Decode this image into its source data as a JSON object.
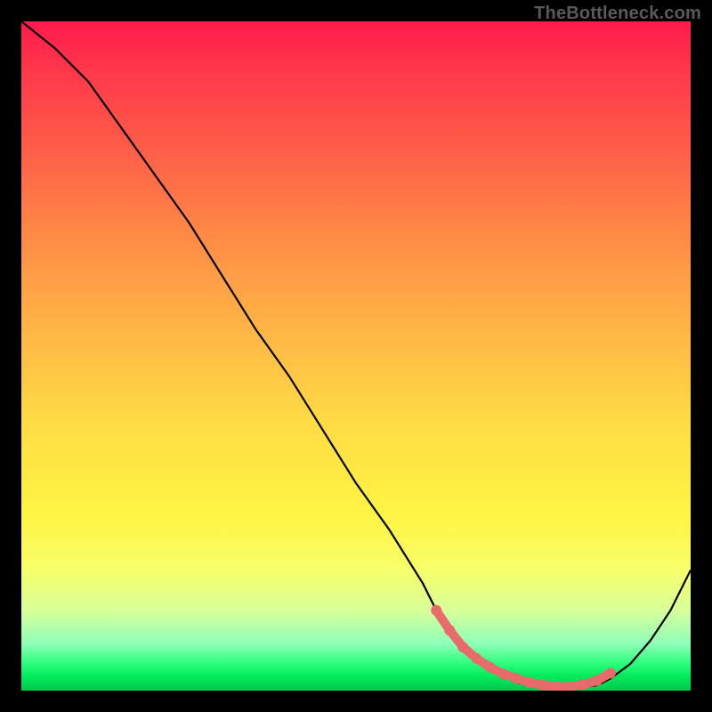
{
  "attribution": "TheBottleneck.com",
  "chart_data": {
    "type": "line",
    "title": "",
    "xlabel": "",
    "ylabel": "",
    "xlim": [
      0,
      100
    ],
    "ylim": [
      0,
      100
    ],
    "series": [
      {
        "name": "bottleneck-curve",
        "x": [
          0,
          5,
          10,
          15,
          20,
          25,
          30,
          35,
          40,
          45,
          50,
          55,
          60,
          62,
          65,
          68,
          71,
          74,
          77,
          80,
          83,
          86,
          88,
          91,
          94,
          97,
          100
        ],
        "y": [
          100,
          96,
          91,
          84,
          77,
          70,
          62,
          54,
          47,
          39,
          31,
          24,
          16,
          12,
          8,
          5,
          2.5,
          1.2,
          0.6,
          0.4,
          0.4,
          0.8,
          1.8,
          4,
          7.5,
          12,
          18
        ]
      }
    ],
    "highlight_band": {
      "name": "optimal-range-dots",
      "x": [
        62,
        64,
        66,
        68,
        70,
        72,
        74,
        76,
        78,
        80,
        82,
        84,
        86,
        88
      ],
      "y": [
        12,
        9,
        6.5,
        4.8,
        3.5,
        2.5,
        1.8,
        1.2,
        0.8,
        0.6,
        0.6,
        0.9,
        1.5,
        2.6
      ]
    },
    "colors": {
      "curve": "#000000",
      "highlight": "#e86a6a",
      "gradient_top": "#ff1a4b",
      "gradient_bottom": "#00c94c"
    }
  }
}
